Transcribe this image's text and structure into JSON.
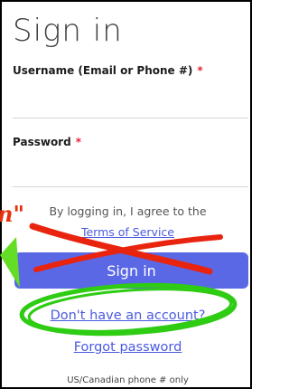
{
  "form": {
    "title": "Sign in",
    "username_label": "Username (Email or Phone #)",
    "password_label": "Password",
    "required_mark": "*",
    "legal_text": "By logging in, I agree to the",
    "terms_link": "Terms of Service",
    "signin_button": "Sign in",
    "create_account_link": "Don't have an account?",
    "forgot_password_link": "Forgot password",
    "phone_note": "US/Canadian phone # only"
  },
  "annotations": {
    "red_text_fragment": "n\"",
    "cross_color": "#e8240f",
    "circle_color": "#2ecc12",
    "arrow_color": "#63dd26"
  }
}
